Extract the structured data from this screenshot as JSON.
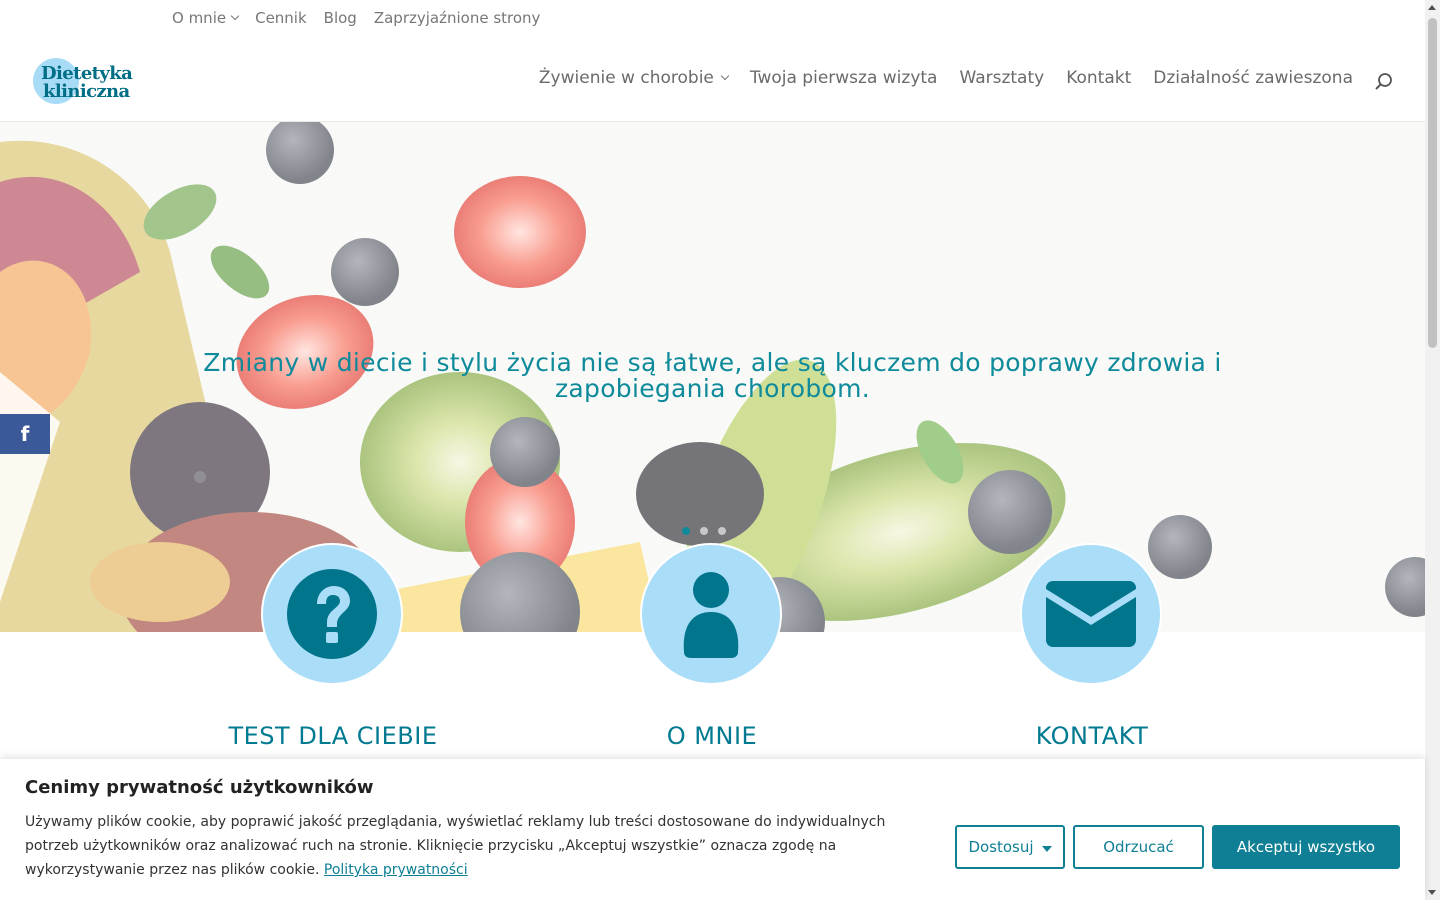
{
  "topnav": {
    "items": [
      {
        "label": "O mnie",
        "has_dropdown": true
      },
      {
        "label": "Cennik"
      },
      {
        "label": "Blog"
      },
      {
        "label": "Zaprzyjaźnione strony"
      }
    ]
  },
  "logo": {
    "line1": "Dietetyka",
    "line2": "kliniczna"
  },
  "mainnav": {
    "items": [
      {
        "label": "Żywienie w chorobie",
        "has_dropdown": true
      },
      {
        "label": "Twoja pierwsza wizyta"
      },
      {
        "label": "Warsztaty"
      },
      {
        "label": "Kontakt"
      },
      {
        "label": "Działalność zawieszona"
      }
    ],
    "search_icon": "search-icon"
  },
  "hero": {
    "text": "Zmiany w diecie i stylu życia nie są łatwe, ale są kluczem do poprawy zdrowia i zapobiegania chorobom.",
    "slides_total": 3,
    "active_slide": 1
  },
  "social": {
    "facebook_label": "f"
  },
  "features": [
    {
      "title": "TEST DLA CIEBIE",
      "icon": "question-icon"
    },
    {
      "title": "O MNIE",
      "icon": "person-icon"
    },
    {
      "title": "KONTAKT",
      "icon": "envelope-icon"
    }
  ],
  "cookie": {
    "title": "Cenimy prywatność użytkowników",
    "text": "Używamy plików cookie, aby poprawić jakość przeglądania, wyświetlać reklamy lub treści dostosowane do indywidualnych potrzeb użytkowników oraz analizować ruch na stronie. Kliknięcie przycisku „Akceptuj wszystkie” oznacza zgodę na wykorzystywanie przez nas plików cookie.",
    "policy_link": "Polityka prywatności",
    "customize_label": "Dostosuj",
    "reject_label": "Odrzucać",
    "accept_label": "Akceptuj wszystko"
  },
  "colors": {
    "accent": "#0e7f94",
    "heading_teal": "#007a91",
    "circle_blue": "#a9ddf8",
    "facebook": "#3b5998"
  }
}
